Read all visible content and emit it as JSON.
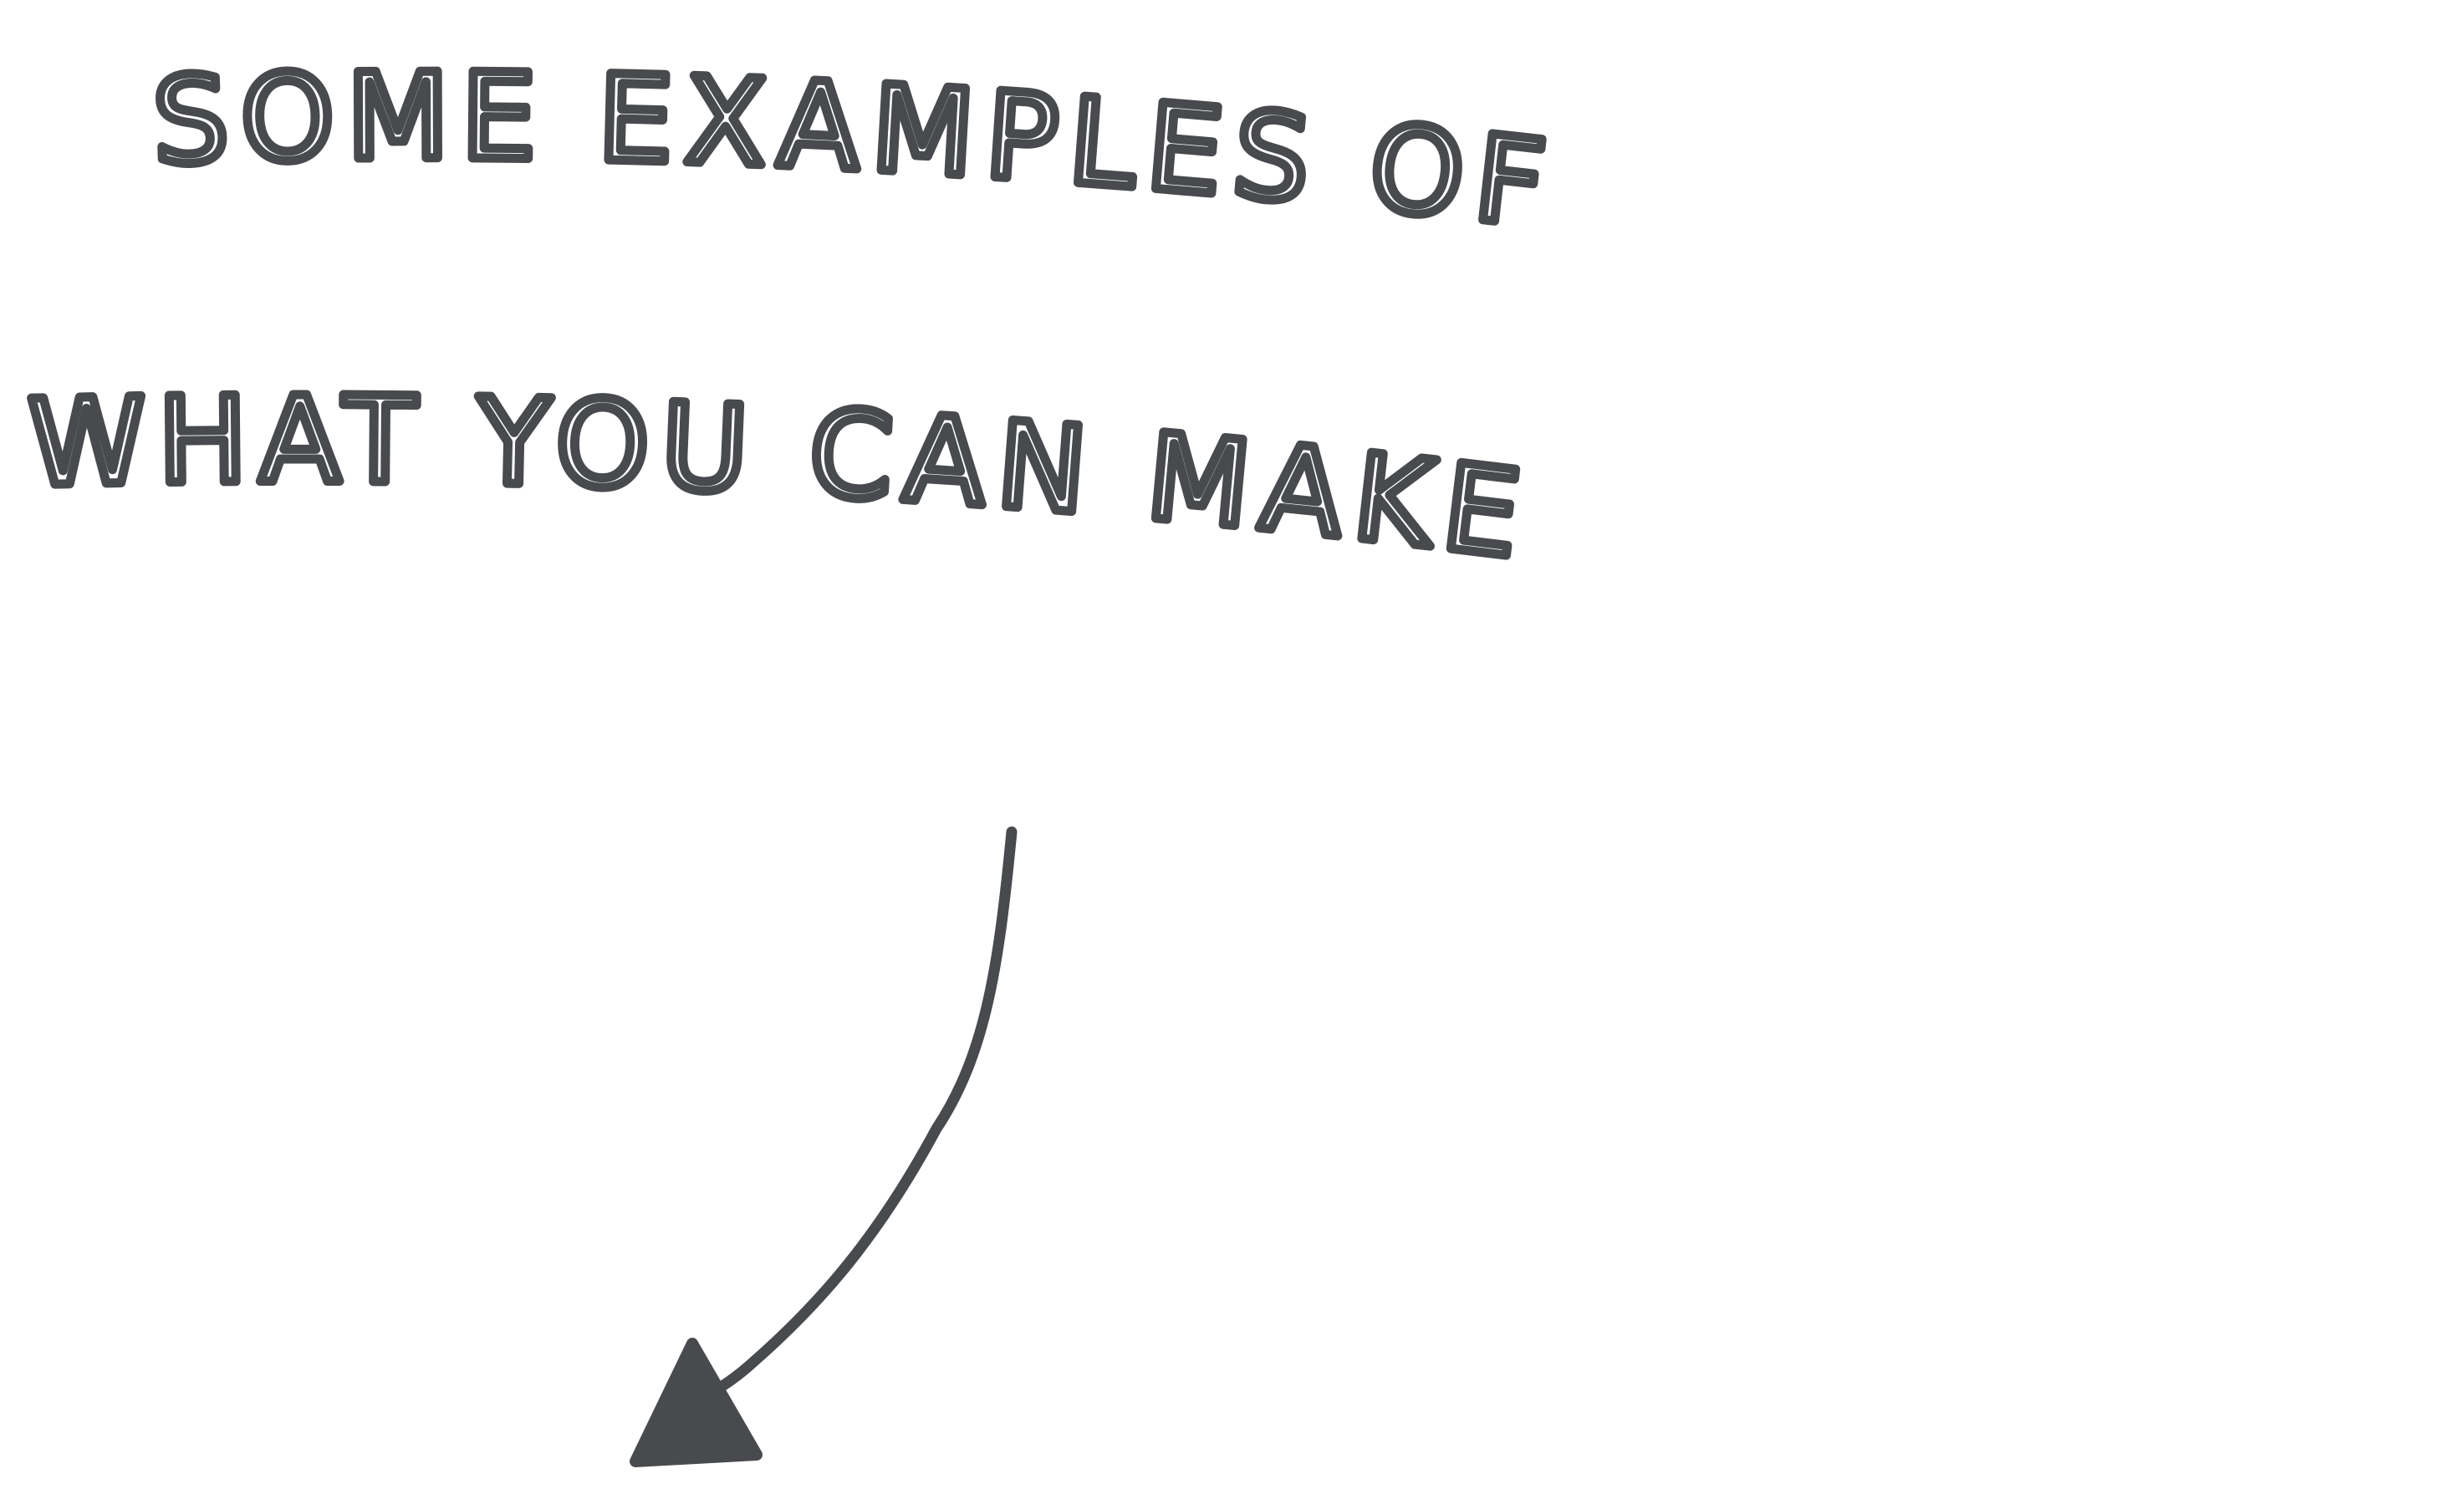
{
  "line1": "SOME EXAMPLES OF",
  "line2": "WHAT YOU CAN MAKE",
  "ink_color": "#484a4d",
  "arrow_icon": "hand-drawn-curved-arrow-down-left"
}
